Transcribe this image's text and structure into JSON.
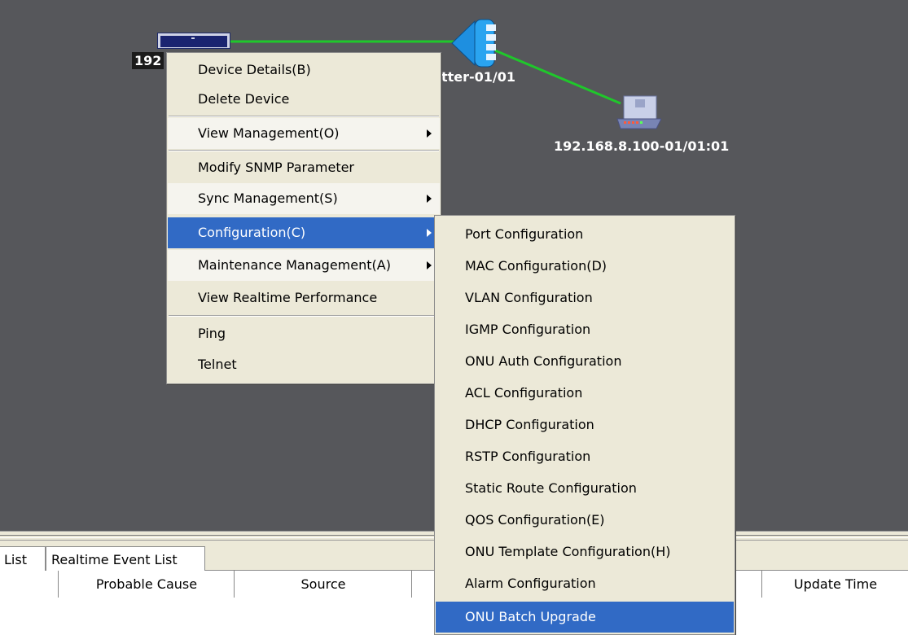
{
  "topology": {
    "olt_label": "192",
    "splitter_label": "litter-01/01",
    "onu_label": "192.168.8.100-01/01:01",
    "link_color": "#1fc72b",
    "background_color": "#56575b"
  },
  "context_menu": {
    "items": [
      {
        "label": "Device Details(B)"
      },
      {
        "label": "Delete Device"
      },
      {
        "label": "View Management(O)"
      },
      {
        "label": "Modify SNMP Parameter"
      },
      {
        "label": "Sync Management(S)"
      },
      {
        "label": "Configuration(C)"
      },
      {
        "label": "Maintenance Management(A)"
      },
      {
        "label": "View Realtime Performance"
      },
      {
        "label": "Ping"
      },
      {
        "label": "Telnet"
      }
    ]
  },
  "configuration_submenu": {
    "items": [
      {
        "label": "Port Configuration"
      },
      {
        "label": "MAC Configuration(D)"
      },
      {
        "label": "VLAN Configuration"
      },
      {
        "label": "IGMP Configuration"
      },
      {
        "label": "ONU Auth Configuration"
      },
      {
        "label": "ACL Configuration"
      },
      {
        "label": "DHCP Configuration"
      },
      {
        "label": "RSTP Configuration"
      },
      {
        "label": "Static Route Configuration"
      },
      {
        "label": "QOS Configuration(E)"
      },
      {
        "label": "ONU Template Configuration(H)"
      },
      {
        "label": "Alarm Configuration"
      },
      {
        "label": "ONU Batch Upgrade"
      }
    ]
  },
  "bottom_panel": {
    "tabs": [
      {
        "label": "List"
      },
      {
        "label": "Realtime Event List"
      }
    ],
    "columns": [
      {
        "label": ""
      },
      {
        "label": "Probable Cause"
      },
      {
        "label": "Source"
      },
      {
        "label": ""
      },
      {
        "label": "Update Time"
      }
    ]
  },
  "colors": {
    "menu_background": "#ece9d8",
    "menu_highlight": "#316ac5"
  }
}
